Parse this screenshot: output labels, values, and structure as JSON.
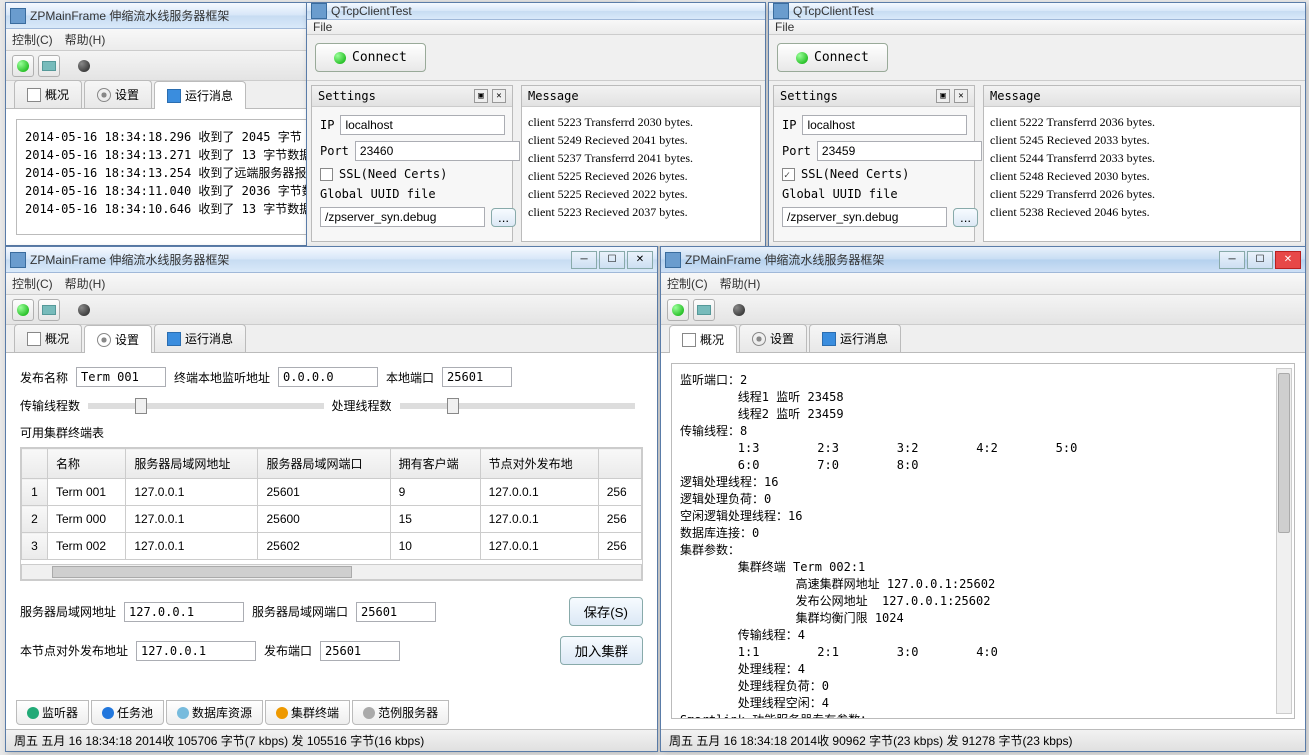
{
  "win1": {
    "title": "ZPMainFrame 伸缩流水线服务器框架",
    "menu": {
      "control": "控制(C)",
      "help": "帮助(H)"
    },
    "tabs": {
      "overview": "概况",
      "settings": "设置",
      "runlog": "运行消息"
    },
    "logs": [
      "2014-05-16 18:34:18.296 收到了 2045 字节",
      "2014-05-16 18:34:13.271 收到了 13 字节数据",
      "2014-05-16 18:34:13.254 收到了远端服务器报",
      "2014-05-16 18:34:11.040 收到了 2036 字节数",
      "2014-05-16 18:34:10.646 收到了 13 字节数据"
    ]
  },
  "qtcp1": {
    "title": "QTcpClientTest",
    "menu_file": "File",
    "connect": "Connect",
    "settings_title": "Settings",
    "ip_lbl": "IP",
    "ip": "localhost",
    "port_lbl": "Port",
    "port": "23460",
    "ssl_lbl": "SSL(Need Certs)",
    "ssl": false,
    "uuid_lbl": "Global UUID file",
    "uuid_path": "/zpserver_syn.debug",
    "dots": "...",
    "msg_title": "Message",
    "msgs": [
      "client 5223 Transferrd 2030 bytes.",
      "client 5249 Recieved 2041 bytes.",
      "client 5237 Transferrd 2041 bytes.",
      "client 5225 Recieved 2026 bytes.",
      "client 5225 Recieved 2022 bytes.",
      "client 5223 Recieved 2037 bytes."
    ]
  },
  "qtcp2": {
    "title": "QTcpClientTest",
    "menu_file": "File",
    "connect": "Connect",
    "settings_title": "Settings",
    "ip_lbl": "IP",
    "ip": "localhost",
    "port_lbl": "Port",
    "port": "23459",
    "ssl_lbl": "SSL(Need Certs)",
    "ssl": true,
    "uuid_lbl": "Global UUID file",
    "uuid_path": "/zpserver_syn.debug",
    "dots": "...",
    "msg_title": "Message",
    "msgs": [
      "client 5222 Transferrd 2036 bytes.",
      "client 5245 Recieved 2033 bytes.",
      "client 5244 Transferrd 2033 bytes.",
      "client 5248 Recieved 2030 bytes.",
      "client 5229 Transferrd 2026 bytes.",
      "client 5238 Recieved 2046 bytes."
    ]
  },
  "win3": {
    "title": "ZPMainFrame 伸缩流水线服务器框架",
    "menu": {
      "control": "控制(C)",
      "help": "帮助(H)"
    },
    "tabs": {
      "overview": "概况",
      "settings": "设置",
      "runlog": "运行消息"
    },
    "form": {
      "pubname_lbl": "发布名称",
      "pubname": "Term 001",
      "listen_lbl": "终端本地监听地址",
      "listen": "0.0.0.0",
      "port_lbl": "本地端口",
      "port": "25601",
      "trans_threads_lbl": "传输线程数",
      "proc_threads_lbl": "处理线程数",
      "cluster_table_lbl": "可用集群终端表"
    },
    "table": {
      "cols": [
        "名称",
        "服务器局域网地址",
        "服务器局域网端口",
        "拥有客户端",
        "节点对外发布地"
      ],
      "rows": [
        [
          "1",
          "Term 001",
          "127.0.0.1",
          "25601",
          "9",
          "127.0.0.1",
          "256"
        ],
        [
          "2",
          "Term 000",
          "127.0.0.1",
          "25600",
          "15",
          "127.0.0.1",
          "256"
        ],
        [
          "3",
          "Term 002",
          "127.0.0.1",
          "25602",
          "10",
          "127.0.0.1",
          "256"
        ]
      ]
    },
    "lower": {
      "lan_addr_lbl": "服务器局域网地址",
      "lan_addr": "127.0.0.1",
      "lan_port_lbl": "服务器局域网端口",
      "lan_port": "25601",
      "pub_addr_lbl": "本节点对外发布地址",
      "pub_addr": "127.0.0.1",
      "pub_port_lbl": "发布端口",
      "pub_port": "25601",
      "save_btn": "保存(S)",
      "join_btn": "加入集群"
    },
    "btabs": [
      "监听器",
      "任务池",
      "数据库资源",
      "集群终端",
      "范例服务器"
    ],
    "status": "周五 五月 16 18:34:18 2014收 105706 字节(7 kbps) 发 105516 字节(16 kbps)"
  },
  "win4": {
    "title": "ZPMainFrame 伸缩流水线服务器框架",
    "menu": {
      "control": "控制(C)",
      "help": "帮助(H)"
    },
    "tabs": {
      "overview": "概况",
      "settings": "设置",
      "runlog": "运行消息"
    },
    "overview": "监听端口：2\n        线程1 监听 23458\n        线程2 监听 23459\n传输线程：8\n        1:3        2:3        3:2        4:2        5:0\n        6:0        7:0        8:0\n逻辑处理线程：16\n逻辑处理负荷：0\n空闲逻辑处理线程：16\n数据库连接：0\n集群参数：\n        集群终端 Term 002:1\n                高速集群网地址 127.0.0.1:25602\n                发布公网地址  127.0.0.1:25602\n                集群均衡门限 1024\n        传输线程：4\n        1:1        2:1        3:0        4:0\n        处理线程：4\n        处理线程负荷：0\n        处理线程空闲：4\nSmartlink 功能服务器专有参数：\n        用户信息数据库：smartlink\n        重要事件数据库：smartlink",
    "status": "周五 五月 16 18:34:18 2014收 90962 字节(23 kbps) 发 91278 字节(23 kbps)"
  }
}
